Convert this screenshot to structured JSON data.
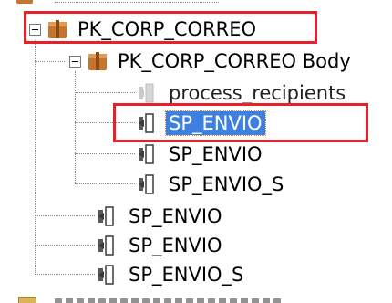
{
  "tree": {
    "package": {
      "label": "PK_CORP_CORREO"
    },
    "package_body": {
      "label": "PK_CORP_CORREO Body"
    },
    "body_children": [
      {
        "label": "process_recipients",
        "icon": "private-procedure-icon",
        "faded": true
      },
      {
        "label": "SP_ENVIO",
        "icon": "procedure-icon",
        "selected": true
      },
      {
        "label": "SP_ENVIO",
        "icon": "procedure-icon"
      },
      {
        "label": "SP_ENVIO_S",
        "icon": "procedure-icon"
      }
    ],
    "spec_children": [
      {
        "label": "SP_ENVIO",
        "icon": "procedure-icon"
      },
      {
        "label": "SP_ENVIO",
        "icon": "procedure-icon"
      },
      {
        "label": "SP_ENVIO_S",
        "icon": "procedure-icon"
      }
    ]
  },
  "colors": {
    "selection": "#3d80df",
    "highlight_box": "#e8202a",
    "package_icon": "#c8742c",
    "procedure_icon": "#5a5a5a"
  }
}
